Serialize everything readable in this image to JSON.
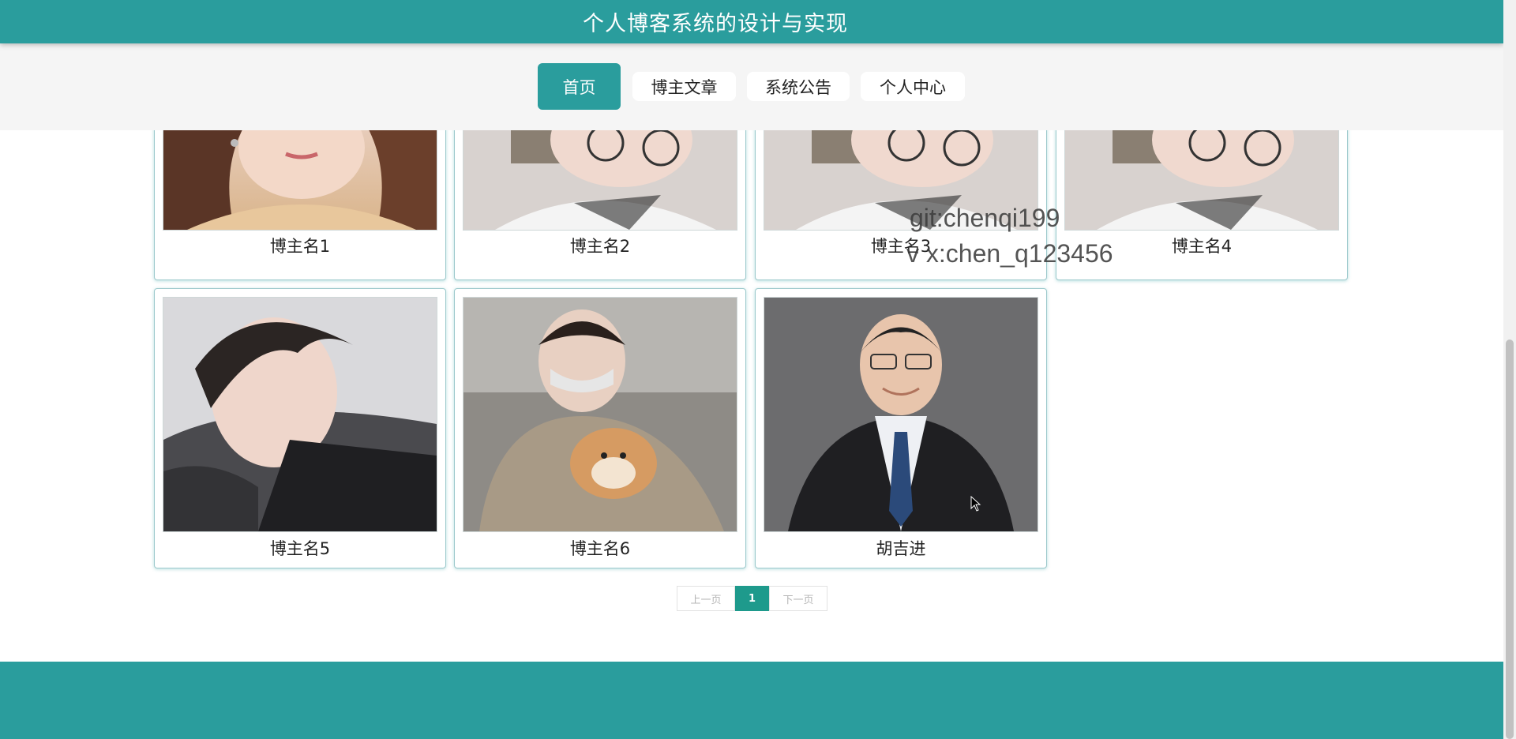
{
  "header": {
    "title": "个人博客系统的设计与实现"
  },
  "nav": {
    "items": [
      {
        "label": "首页"
      },
      {
        "label": "博主文章"
      },
      {
        "label": "系统公告"
      },
      {
        "label": "个人中心"
      }
    ]
  },
  "bloggers": [
    {
      "name": "博主名1"
    },
    {
      "name": "博主名2"
    },
    {
      "name": "博主名3"
    },
    {
      "name": "博主名4"
    },
    {
      "name": "博主名5"
    },
    {
      "name": "博主名6"
    },
    {
      "name": "胡吉进"
    }
  ],
  "pagination": {
    "prev": "上一页",
    "current": "1",
    "next": "下一页"
  },
  "watermark": {
    "line1": "git:chenqi199",
    "line2": "v x:chen_q123456"
  },
  "colors": {
    "primary": "#2a9d9d",
    "page_active": "#1e9a8c",
    "nav_bg": "#f5f5f5"
  }
}
